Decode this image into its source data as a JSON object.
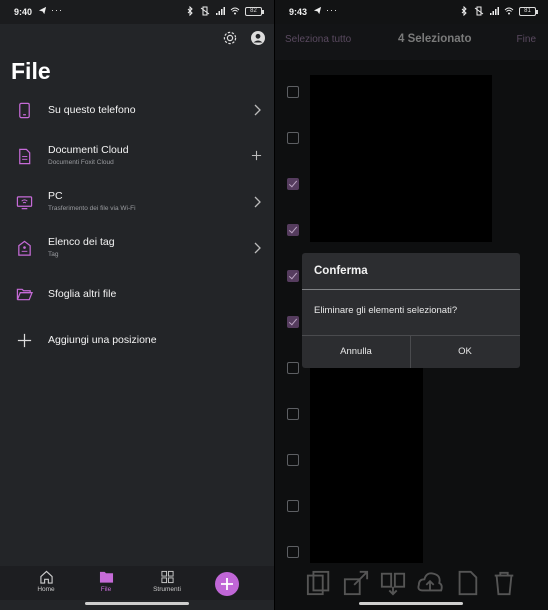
{
  "left": {
    "status": {
      "time": "9:40",
      "battery": "82"
    },
    "title": "File",
    "items": [
      {
        "label": "Su questo telefono",
        "sub": "",
        "trail": "chevron"
      },
      {
        "label": "Documenti Cloud",
        "sub": "Documenti Foxit Cloud",
        "trail": "plus"
      },
      {
        "label": "PC",
        "sub": "Trasferimento dei file via Wi-Fi",
        "trail": "chevron"
      },
      {
        "label": "Elenco dei tag",
        "sub": "Tag",
        "trail": "chevron"
      },
      {
        "label": "Sfoglia altri file",
        "sub": "",
        "trail": ""
      },
      {
        "label": "Aggiungi una posizione",
        "sub": "",
        "trail": ""
      }
    ],
    "bottom_nav": [
      {
        "label": "Home",
        "icon": "home-icon"
      },
      {
        "label": "File",
        "icon": "folder-icon"
      },
      {
        "label": "Strumenti",
        "icon": "tools-icon"
      }
    ]
  },
  "right": {
    "status": {
      "time": "9:43",
      "battery": "81"
    },
    "header": {
      "select_all": "Seleziona tutto",
      "count": "4 Selezionato",
      "done": "Fine"
    },
    "dialog": {
      "title": "Conferma",
      "message": "Eliminare gli elementi selezionati?",
      "cancel": "Annulla",
      "ok": "OK"
    }
  },
  "colors": {
    "accent": "#c066d6",
    "panel": "#232528",
    "dialog": "#2c2d30"
  }
}
